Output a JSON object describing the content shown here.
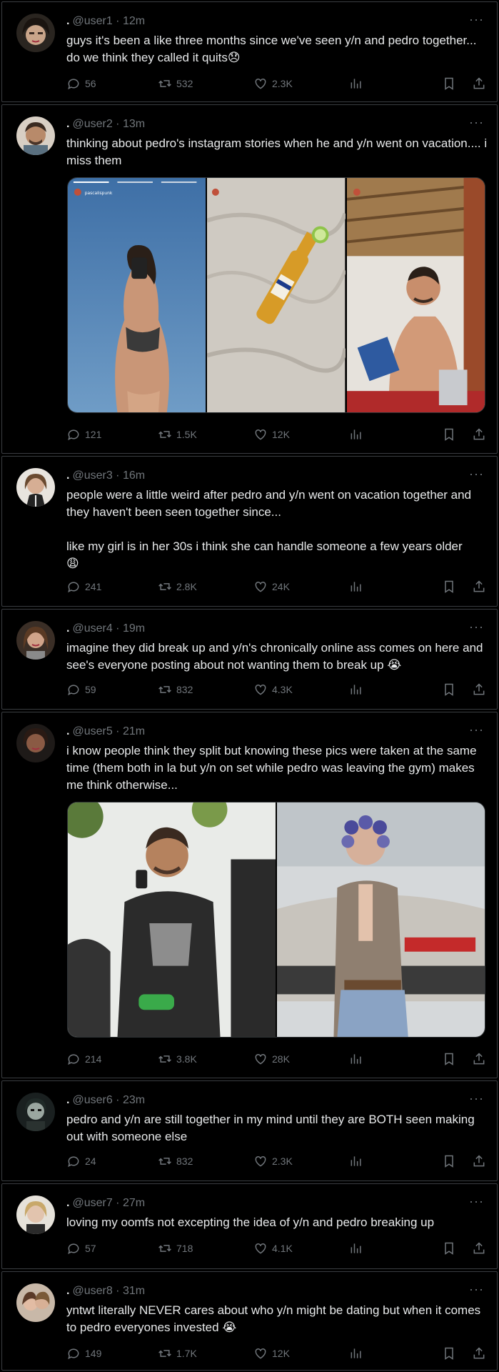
{
  "tweets": [
    {
      "user": "@user1",
      "time": "12m",
      "text": "guys it's been a like three months since we've seen y/n and pedro together... do we think they called it quits",
      "emoji": "😞",
      "replies": "56",
      "retweets": "532",
      "likes": "2.3K"
    },
    {
      "user": "@user2",
      "time": "13m",
      "text": "thinking about pedro's instagram stories when he and y/n went on vacation.... i miss them",
      "emoji": "",
      "replies": "121",
      "retweets": "1.5K",
      "likes": "12K",
      "media_caption": "pascalispunk"
    },
    {
      "user": "@user3",
      "time": "16m",
      "text": "people were a little weird after pedro and y/n went on vacation together and they haven't been seen together since...\n\nlike my girl is in her 30s i think she can handle someone a few years older",
      "emoji": "😩",
      "replies": "241",
      "retweets": "2.8K",
      "likes": "24K"
    },
    {
      "user": "@user4",
      "time": "19m",
      "text": "imagine they did break up and y/n's chronically online ass comes on here and see's everyone posting about not wanting them to break up",
      "emoji": "😭",
      "replies": "59",
      "retweets": "832",
      "likes": "4.3K"
    },
    {
      "user": "@user5",
      "time": "21m",
      "text": "i know people think they split but knowing these pics were taken at the same time (them both in la but y/n on set while pedro was leaving the gym) makes me think otherwise...",
      "emoji": "",
      "replies": "214",
      "retweets": "3.8K",
      "likes": "28K"
    },
    {
      "user": "@user6",
      "time": "23m",
      "text": "pedro and y/n are still together in my mind until they are BOTH seen making out with someone else",
      "emoji": "",
      "replies": "24",
      "retweets": "832",
      "likes": "2.3K"
    },
    {
      "user": "@user7",
      "time": "27m",
      "text": "loving my oomfs not excepting the idea of y/n and pedro breaking up",
      "emoji": "",
      "replies": "57",
      "retweets": "718",
      "likes": "4.1K"
    },
    {
      "user": "@user8",
      "time": "31m",
      "text": "yntwt literally NEVER cares about who y/n might be dating but when it comes to pedro everyones invested",
      "emoji": "😭",
      "replies": "149",
      "retweets": "1.7K",
      "likes": "12K"
    }
  ],
  "labels": {
    "separator": "·",
    "dot": ".",
    "more": "···"
  }
}
